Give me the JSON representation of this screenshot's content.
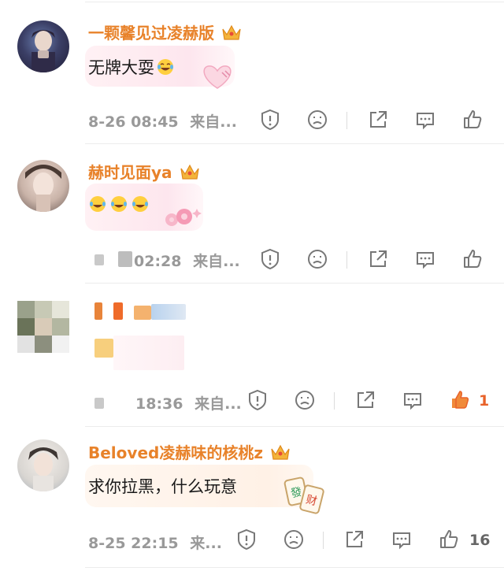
{
  "comments": [
    {
      "username": "一颗馨见过凌赫版",
      "text": "无牌大耍",
      "emoji": "laugh-cry-emoji",
      "timestamp": "8-26 08:45",
      "source": "来自...",
      "likes": ""
    },
    {
      "username": "赫时见面ya",
      "text": "",
      "emoji": "laugh-cry-emoji x3",
      "timestamp": "02:28",
      "source": "来自...",
      "likes": ""
    },
    {
      "username": "",
      "text": "",
      "timestamp": "18:36",
      "source": "来自...",
      "likes": "1"
    },
    {
      "username": "Beloved凌赫味的核桃z",
      "text": "求你拉黑，什么玩意",
      "emoji": "mahjong-fa-cai-sticker",
      "timestamp": "8-25 22:15",
      "source": "来...",
      "likes": "16"
    }
  ],
  "colors": {
    "username": "#e8822a",
    "like_active": "#e8622a",
    "meta": "#999999"
  }
}
